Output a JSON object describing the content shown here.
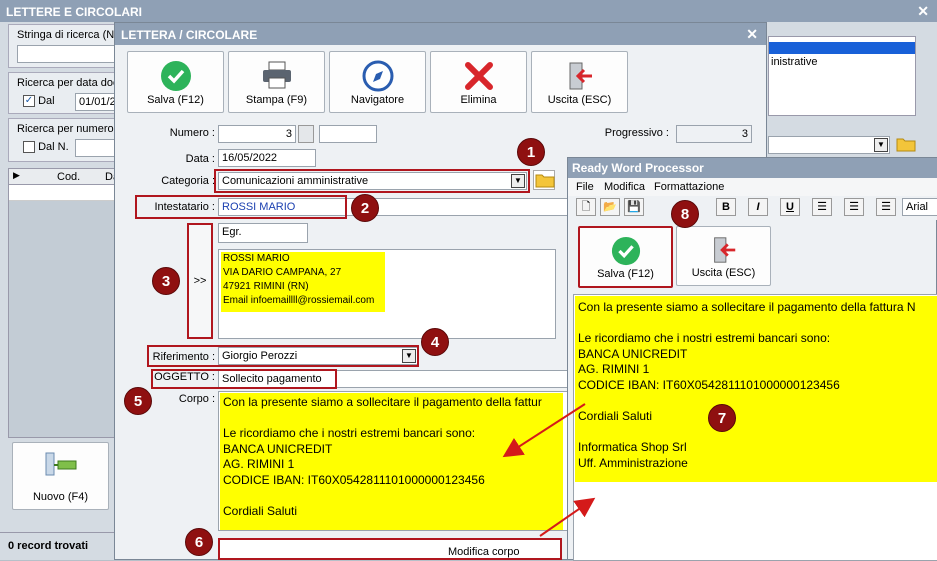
{
  "bg_window": {
    "title": "LETTERE E CIRCOLARI",
    "search_label": "Stringa di ricerca (Nu",
    "date_search_label": "Ricerca per data doc",
    "date_check_label": "Dal",
    "date_value": "01/01/2",
    "number_search_label": "Ricerca per numero",
    "number_check_label": "Dal N.",
    "col_cod": "Cod.",
    "col_da": "Da",
    "new_button": "Nuovo (F4)",
    "status": "0 record trovati",
    "list_item": "inistrative"
  },
  "letter_window": {
    "title": "LETTERA / CIRCOLARE",
    "toolbar": {
      "save": "Salva (F12)",
      "print": "Stampa (F9)",
      "navigator": "Navigatore",
      "delete": "Elimina",
      "exit": "Uscita (ESC)"
    },
    "numero_label": "Numero :",
    "numero_value": "3",
    "progressivo_label": "Progressivo :",
    "progressivo_value": "3",
    "data_label": "Data :",
    "data_value": "16/05/2022",
    "categoria_label": "Categoria :",
    "categoria_value": "Comunicazioni amministrative",
    "intestatario_label": "Intestatario :",
    "intestatario_value": "ROSSI MARIO",
    "salutation": "Egr.",
    "arrow_label": ">>",
    "address": "ROSSI MARIO\nVIA DARIO CAMPANA, 27\n47921 RIMINI (RN)\nEmail infoemaillll@rossiemail.com",
    "riferimento_label": "Riferimento :",
    "riferimento_value": "Giorgio Perozzi",
    "oggetto_label": "OGGETTO :",
    "oggetto_value": "Sollecito pagamento",
    "corpo_label": "Corpo :",
    "body_text": "Con la presente siamo a sollecitare il pagamento della fattur\n\nLe ricordiamo che i nostri estremi bancari sono:\nBANCA UNICREDIT\nAG. RIMINI 1\nCODICE IBAN: IT60X0542811101000000123456\n\nCordiali Saluti",
    "modify_body_button": "Modifica corpo"
  },
  "word_processor": {
    "title": "Ready Word Processor",
    "menu": [
      "File",
      "Modifica",
      "Formattazione"
    ],
    "font_name": "Arial",
    "save": "Salva (F12)",
    "exit": "Uscita (ESC)",
    "body_text": "Con la presente siamo a sollecitare il pagamento della fattura N\n\nLe ricordiamo che i nostri estremi bancari sono:\nBANCA UNICREDIT\nAG. RIMINI 1\nCODICE IBAN: IT60X0542811101000000123456\n\nCordiali Saluti\n\nInformatica Shop Srl\nUff. Amministrazione"
  },
  "callouts": [
    "1",
    "2",
    "3",
    "4",
    "5",
    "6",
    "7",
    "8"
  ],
  "colors": {
    "callout": "#8f1010",
    "highlight": "#ffff00",
    "title_bar": "#8fa0b5",
    "link_blue": "#1a3fb0"
  }
}
